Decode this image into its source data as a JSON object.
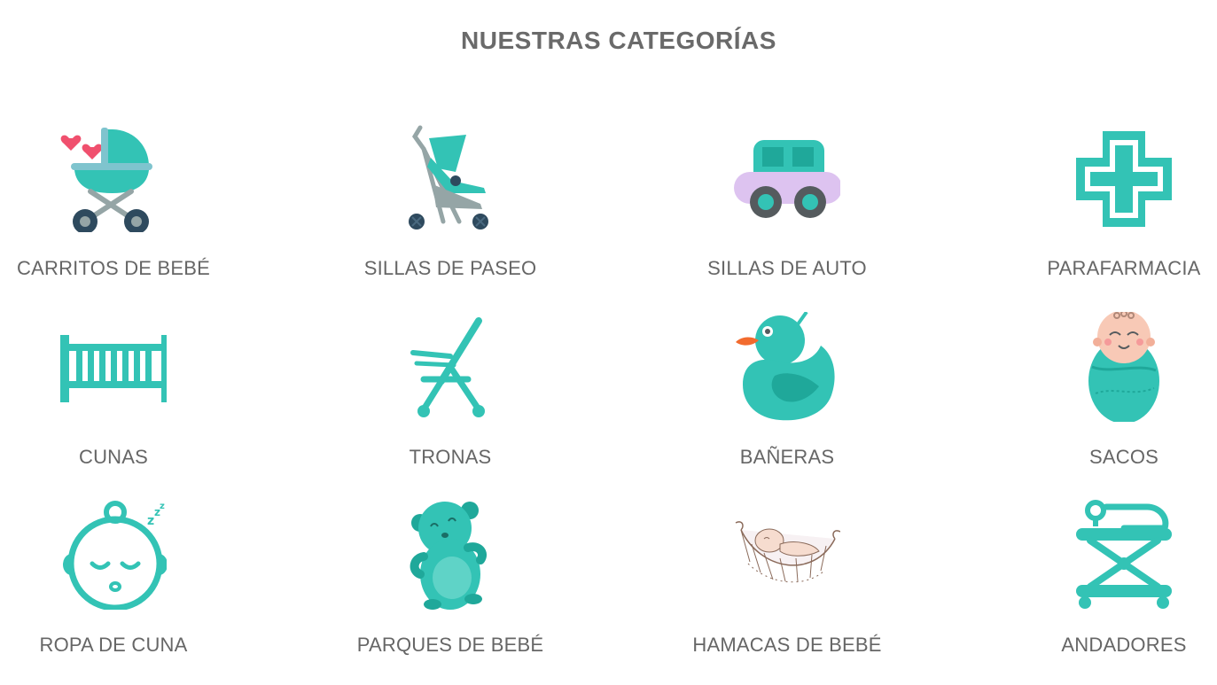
{
  "section": {
    "title": "NUESTRAS CATEGORÍAS"
  },
  "colors": {
    "teal": "#33C3B5",
    "teal_dark": "#1FA89A",
    "text": "#666666",
    "heart": "#F0506E",
    "dark": "#2E4A5E"
  },
  "categories": [
    {
      "label": "CARRITOS DE BEBÉ",
      "icon": "stroller-with-hearts-icon"
    },
    {
      "label": "SILLAS DE PASEO",
      "icon": "umbrella-stroller-icon"
    },
    {
      "label": "SILLAS DE AUTO",
      "icon": "toy-car-icon"
    },
    {
      "label": "PARAFARMACIA",
      "icon": "pharmacy-cross-icon"
    },
    {
      "label": "CUNAS",
      "icon": "crib-icon"
    },
    {
      "label": "TRONAS",
      "icon": "high-chair-icon"
    },
    {
      "label": "BAÑERAS",
      "icon": "rubber-duck-icon"
    },
    {
      "label": "SACOS",
      "icon": "swaddled-baby-icon"
    },
    {
      "label": "ROPA DE CUNA",
      "icon": "sleeping-baby-icon"
    },
    {
      "label": "PARQUES DE BEBÉ",
      "icon": "teddy-bear-icon"
    },
    {
      "label": "HAMACAS DE BEBÉ",
      "icon": "baby-hammock-icon"
    },
    {
      "label": "ANDADORES",
      "icon": "baby-walker-icon"
    }
  ]
}
